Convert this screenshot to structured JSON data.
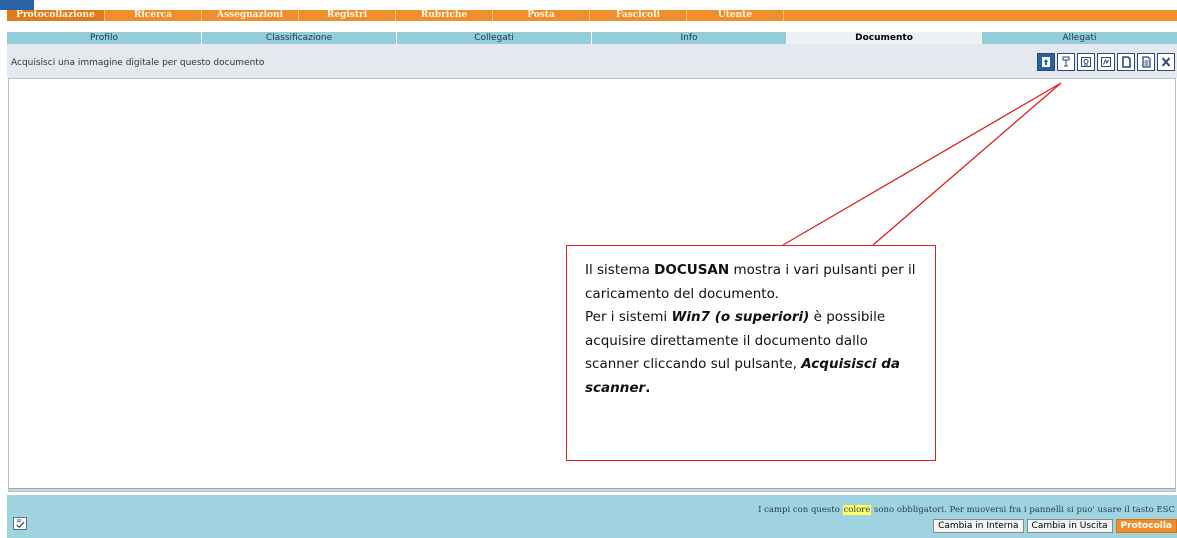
{
  "menu": {
    "items": [
      {
        "label": "Protocollazione"
      },
      {
        "label": "Ricerca"
      },
      {
        "label": "Assegnazioni"
      },
      {
        "label": "Registri"
      },
      {
        "label": "Rubriche"
      },
      {
        "label": "Posta"
      },
      {
        "label": "Fascicoli"
      },
      {
        "label": "Utente"
      }
    ]
  },
  "tabs": [
    {
      "label": "Profilo"
    },
    {
      "label": "Classificazione"
    },
    {
      "label": "Collegati"
    },
    {
      "label": "Info"
    },
    {
      "label": "Documento"
    },
    {
      "label": "Allegati"
    }
  ],
  "subbar": {
    "hint": "Acquisisci una immagine digitale per questo documento"
  },
  "toolbar": {
    "icons": [
      "upload-icon",
      "scanner-icon",
      "webcam-icon",
      "pdf-icon",
      "new-page-icon",
      "document-icon",
      "close-icon"
    ]
  },
  "callout": {
    "p1_pre": "Il sistema ",
    "p1_bold": "DOCUSAN",
    "p1_post": " mostra i vari pulsanti per il caricamento del documento.",
    "p2_pre": "Per i sistemi ",
    "p2_bold_italic": "Win7 (o superiori)",
    "p2_mid": " è possibile acquisire direttamente il documento dallo scanner cliccando sul pulsante, ",
    "p2_bold_italic_2": "Acquisisci da scanner",
    "p2_end": "."
  },
  "footer": {
    "note_pre": "I campi con questo ",
    "note_colore": "colore",
    "note_post": " sono obbligatori. Per muoversi fra i pannelli si puo' usare il tasto ESC",
    "buttons": {
      "interna": "Cambia in Interna",
      "uscita": "Cambia in Uscita",
      "protocolla": "Protocolla"
    }
  },
  "colors": {
    "menu_orange": "#f08e2d",
    "tab_teal": "#94cdd9",
    "footer_blue": "#9fd3e0",
    "callout_red": "#e02020",
    "corner_blue": "#2a63a8"
  }
}
